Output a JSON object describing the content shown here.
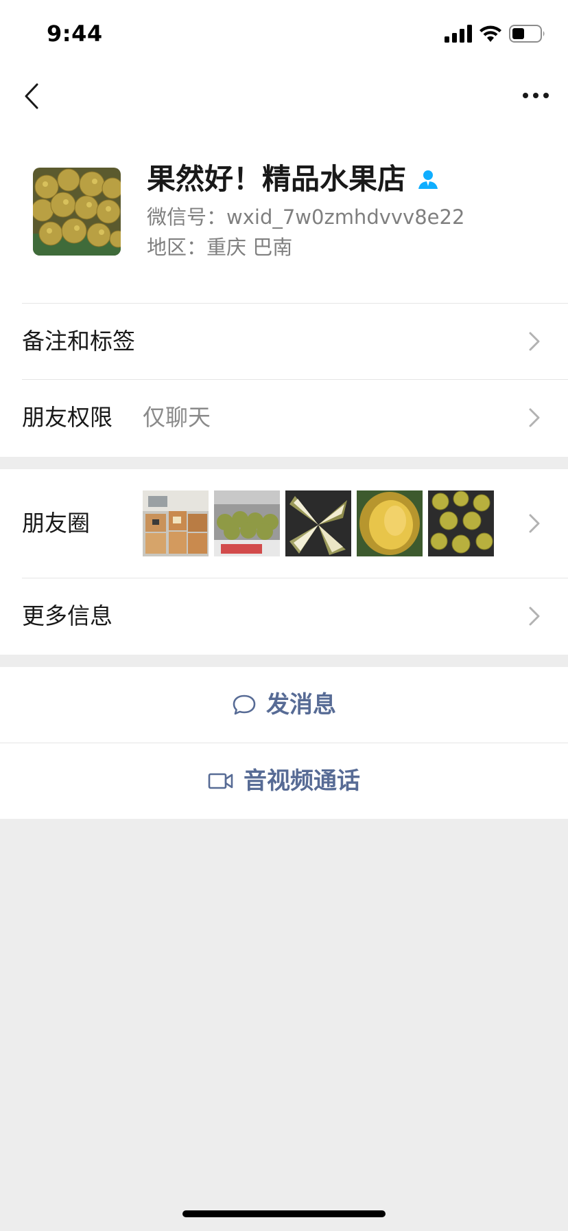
{
  "status_bar": {
    "time": "9:44"
  },
  "nav": {
    "back_icon": "chevron-left-icon",
    "more_icon": "more-dots-icon"
  },
  "profile": {
    "name": "果然好！精品水果店",
    "wechat_id": "微信号：wxid_7w0zmhdvvv8e22",
    "region": "地区：重庆 巴南",
    "verified_icon": "contact-person-icon",
    "verified_color": "#10aeff"
  },
  "rows": {
    "remarks": {
      "label": "备注和标签"
    },
    "permissions": {
      "label": "朋友权限",
      "value": "仅聊天"
    },
    "moments": {
      "label": "朋友圈"
    },
    "more_info": {
      "label": "更多信息"
    }
  },
  "actions": {
    "message": {
      "label": "发消息",
      "icon": "chat-bubble-icon"
    },
    "call": {
      "label": "音视频通话",
      "icon": "video-camera-icon"
    }
  },
  "colors": {
    "link": "#576b95",
    "background": "#ededed",
    "text_primary": "#191919",
    "text_secondary": "#7f7f7f"
  }
}
